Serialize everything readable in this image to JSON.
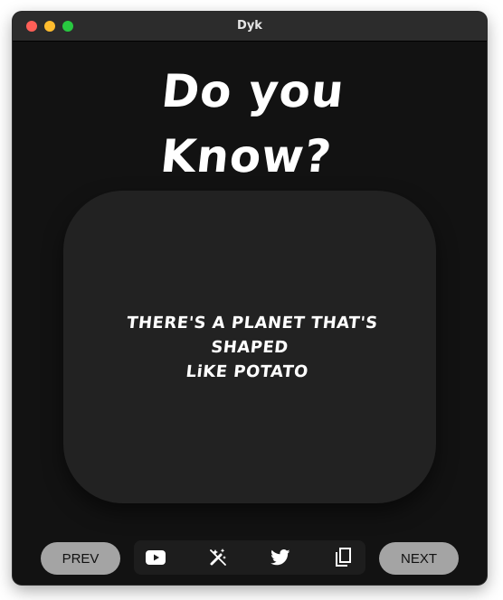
{
  "window": {
    "title": "Dyk"
  },
  "main": {
    "heading_line1": "Do you",
    "heading_line2": "Know?",
    "fact_line1": "THERE'S A PLANET THAT'S SHAPED",
    "fact_line2": "LiKE POTATO"
  },
  "toolbar": {
    "prev_label": "PREV",
    "next_label": "NEXT",
    "icons": [
      "youtube-icon",
      "magic-wand-off-icon",
      "twitter-icon",
      "copy-icon"
    ]
  },
  "colors": {
    "window_bg": "#121212",
    "card_bg": "#222222",
    "button_bg": "#a4a4a4",
    "icon_bar_bg": "#1d1d1d",
    "text": "#ffffff"
  }
}
